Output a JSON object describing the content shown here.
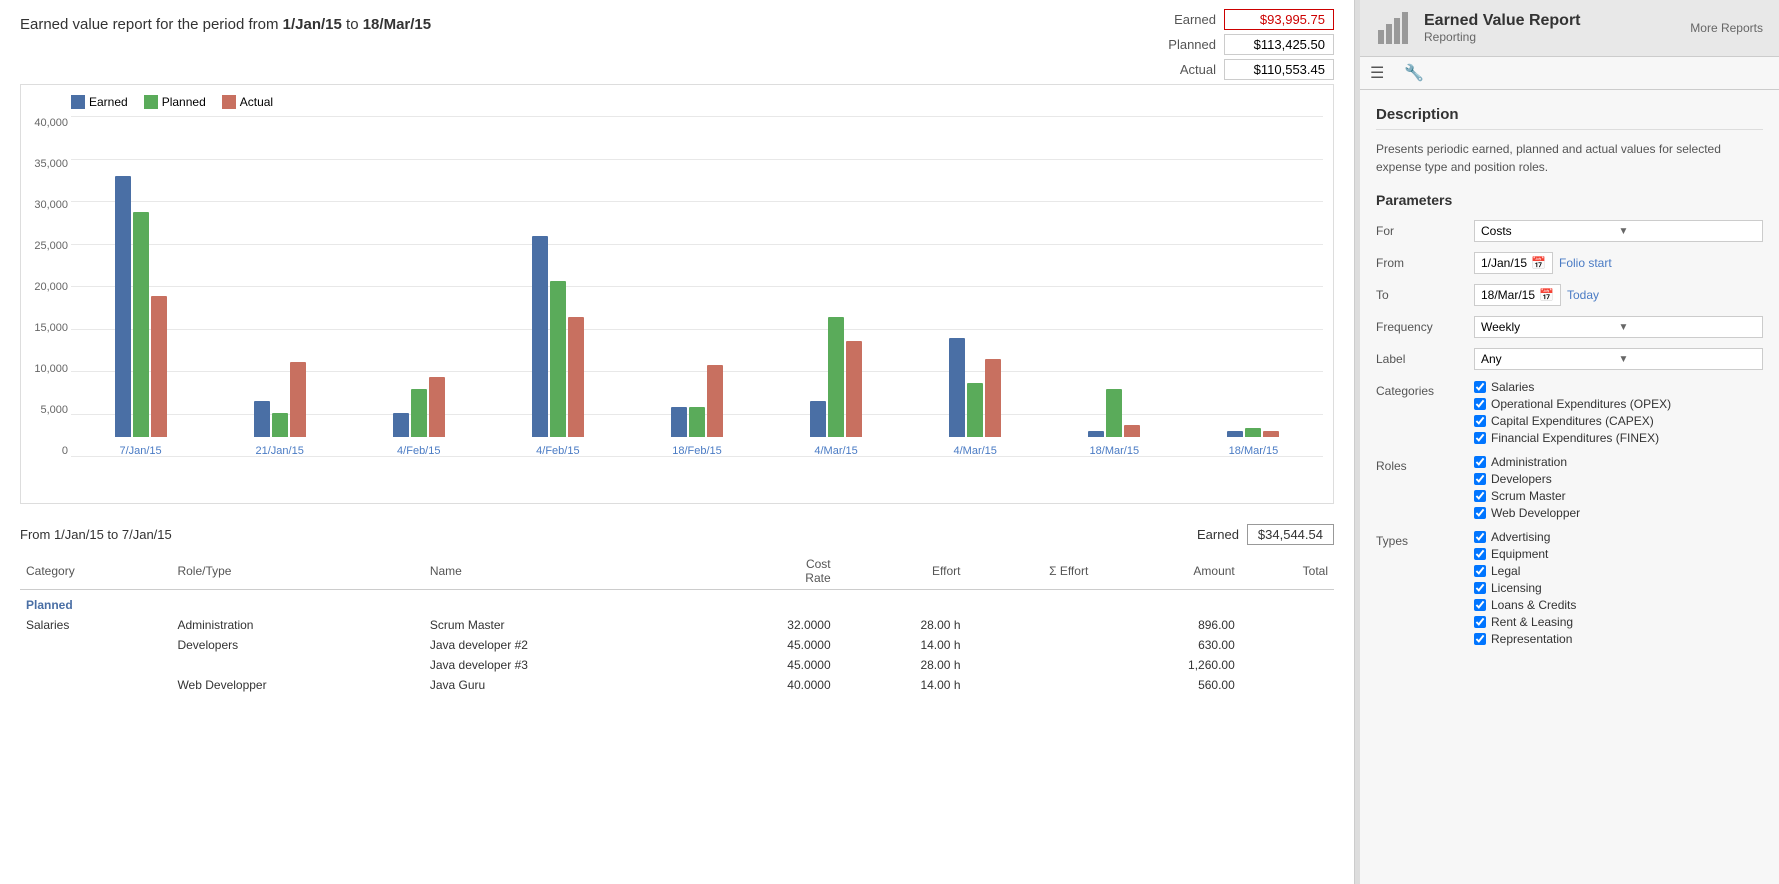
{
  "report": {
    "title_prefix": "Earned value report for the period from ",
    "date_from": "1/Jan/15",
    "date_to": "18/Mar/15",
    "summary": {
      "earned_label": "Earned",
      "earned_value": "$93,995.75",
      "planned_label": "Planned",
      "planned_value": "$113,425.50",
      "actual_label": "Actual",
      "actual_value": "$110,553.45"
    }
  },
  "chart": {
    "legend": {
      "earned": "Earned",
      "planned": "Planned",
      "actual": "Actual"
    },
    "y_axis": [
      "40,000",
      "35,000",
      "30,000",
      "25,000",
      "20,000",
      "15,000",
      "10,000",
      "5,000",
      "0"
    ],
    "groups": [
      {
        "label": "7/Jan/15",
        "earned_pct": 87,
        "planned_pct": 75,
        "actual_pct": 47
      },
      {
        "label": "21/Jan/15",
        "earned_pct": 12,
        "planned_pct": 8,
        "actual_pct": 25
      },
      {
        "label": "4/Feb/15",
        "earned_pct": 8,
        "planned_pct": 16,
        "actual_pct": 20
      },
      {
        "label": "4/Feb/15b",
        "earned_pct": 67,
        "planned_pct": 52,
        "actual_pct": 40
      },
      {
        "label": "18/Feb/15",
        "earned_pct": 10,
        "planned_pct": 10,
        "actual_pct": 24
      },
      {
        "label": "4/Mar/15",
        "earned_pct": 12,
        "planned_pct": 40,
        "actual_pct": 32
      },
      {
        "label": "4/Mar/15b",
        "earned_pct": 33,
        "planned_pct": 18,
        "actual_pct": 26
      },
      {
        "label": "18/Mar/15",
        "earned_pct": 2,
        "planned_pct": 16,
        "actual_pct": 4
      },
      {
        "label": "18/Mar/15b",
        "earned_pct": 2,
        "planned_pct": 3,
        "actual_pct": 2
      }
    ]
  },
  "period_section": {
    "title": "From 1/Jan/15 to 7/Jan/15",
    "earned_label": "Earned",
    "earned_value": "$34,544.54",
    "table": {
      "headers": [
        "Category",
        "Role/Type",
        "Name",
        "Cost Rate",
        "Effort",
        "Σ Effort",
        "Amount",
        "Total"
      ],
      "planned_label": "Planned",
      "rows": [
        {
          "category": "Salaries",
          "role": "Administration",
          "name": "Scrum Master",
          "cost_rate": "32.0000",
          "effort": "28.00 h",
          "sigma_effort": "",
          "amount": "896.00",
          "total": ""
        },
        {
          "category": "",
          "role": "Developers",
          "name": "Java developer #2",
          "cost_rate": "45.0000",
          "effort": "14.00 h",
          "sigma_effort": "",
          "amount": "630.00",
          "total": ""
        },
        {
          "category": "",
          "role": "",
          "name": "Java developer #3",
          "cost_rate": "45.0000",
          "effort": "28.00 h",
          "sigma_effort": "",
          "amount": "1,260.00",
          "total": ""
        },
        {
          "category": "",
          "role": "Web Developper",
          "name": "Java Guru",
          "cost_rate": "40.0000",
          "effort": "14.00 h",
          "sigma_effort": "",
          "amount": "560.00",
          "total": ""
        }
      ]
    }
  },
  "sidebar": {
    "title": "Earned Value Report",
    "subtitle": "Reporting",
    "more_reports": "More Reports",
    "description_title": "Description",
    "description": "Presents periodic earned, planned and actual values for selected expense type and position roles.",
    "parameters_title": "Parameters",
    "params": {
      "for_label": "For",
      "for_value": "Costs",
      "from_label": "From",
      "from_date": "1/Jan/15",
      "from_link": "Folio start",
      "to_label": "To",
      "to_date": "18/Mar/15",
      "to_link": "Today",
      "frequency_label": "Frequency",
      "frequency_value": "Weekly",
      "label_label": "Label",
      "label_value": "Any",
      "categories_label": "Categories",
      "categories": [
        "Salaries",
        "Operational Expenditures (OPEX)",
        "Capital Expenditures (CAPEX)",
        "Financial Expenditures (FINEX)"
      ],
      "roles_label": "Roles",
      "roles": [
        "Administration",
        "Developers",
        "Scrum Master",
        "Web Developper"
      ],
      "types_label": "Types",
      "types": [
        "Advertising",
        "Equipment",
        "Legal",
        "Licensing",
        "Loans & Credits",
        "Rent & Leasing",
        "Representation"
      ]
    }
  }
}
